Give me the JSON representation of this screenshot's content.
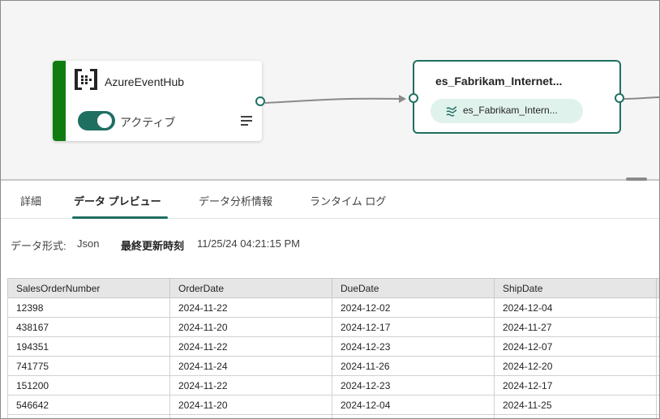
{
  "source_node": {
    "title": "AzureEventHub",
    "toggle_label": "アクティブ",
    "toggle_on": true,
    "accent_color": "#107c10"
  },
  "stream_node": {
    "title": "es_Fabrikam_Internet...",
    "pill_label": "es_Fabrikam_Intern...",
    "border_color": "#1f6f61"
  },
  "tabs": [
    {
      "label": "詳細",
      "active": false
    },
    {
      "label": "データ プレビュー",
      "active": true
    },
    {
      "label": "データ分析情報",
      "active": false
    },
    {
      "label": "ランタイム ログ",
      "active": false
    }
  ],
  "meta": {
    "format_label": "データ形式:",
    "format_value": "Json",
    "updated_label": "最終更新時刻",
    "updated_value": "11/25/24 04:21:15 PM"
  },
  "table": {
    "columns": [
      "SalesOrderNumber",
      "OrderDate",
      "DueDate",
      "ShipDate"
    ],
    "rows": [
      [
        "12398",
        "2024-11-22",
        "2024-12-02",
        "2024-12-04"
      ],
      [
        "438167",
        "2024-11-20",
        "2024-12-17",
        "2024-11-27"
      ],
      [
        "194351",
        "2024-11-22",
        "2024-12-23",
        "2024-12-07"
      ],
      [
        "741775",
        "2024-11-24",
        "2024-11-26",
        "2024-12-20"
      ],
      [
        "151200",
        "2024-11-22",
        "2024-12-23",
        "2024-12-17"
      ],
      [
        "546642",
        "2024-11-20",
        "2024-12-04",
        "2024-11-25"
      ],
      [
        "",
        "",
        "",
        ""
      ]
    ]
  },
  "icons": {
    "source": "event-hub-icon",
    "menu": "menu-lines-icon",
    "stream": "stream-icon"
  }
}
